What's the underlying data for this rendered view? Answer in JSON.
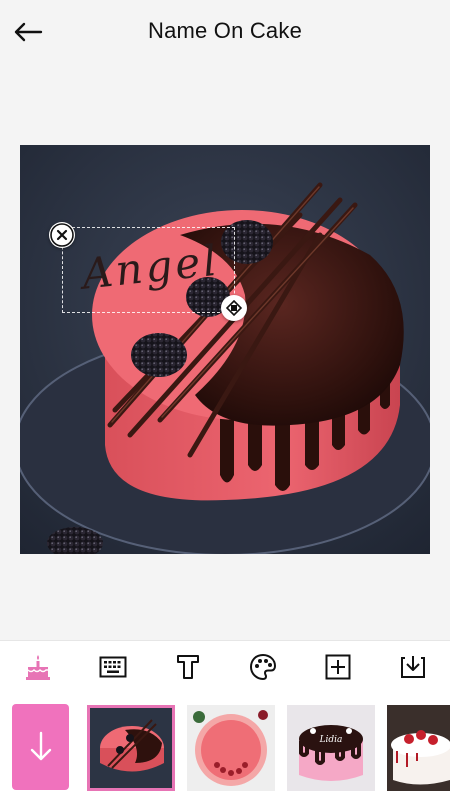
{
  "header": {
    "title": "Name On Cake"
  },
  "canvas": {
    "overlay_text": "Angel"
  },
  "toolbar": {
    "tools": [
      "cake-icon",
      "keyboard-icon",
      "font-icon",
      "palette-icon",
      "add-icon",
      "download-icon"
    ],
    "active_tool": "cake-icon",
    "accent_color": "#e774b5"
  },
  "cake_strip": {
    "button_color": "#f072bd",
    "selected_index": 0,
    "thumbnails": [
      "pink-velvet-chocolate-drip-cake",
      "pink-tart-with-berries",
      "chocolate-top-pink-drip-cake-lidia",
      "white-cake-with-strawberries"
    ],
    "thumb_text": "Lidia"
  }
}
